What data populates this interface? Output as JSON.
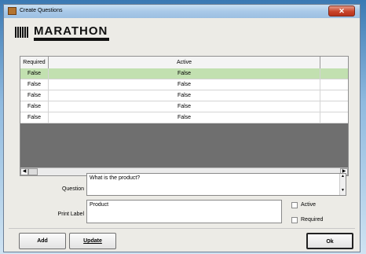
{
  "window": {
    "title": "Create Questions"
  },
  "logo": {
    "text": "MARATHON"
  },
  "grid": {
    "columns": {
      "required": "Required",
      "active": "Active"
    },
    "rows": [
      {
        "required": "False",
        "active": "False",
        "selected": true
      },
      {
        "required": "False",
        "active": "False",
        "selected": false
      },
      {
        "required": "False",
        "active": "False",
        "selected": false
      },
      {
        "required": "False",
        "active": "False",
        "selected": false
      },
      {
        "required": "False",
        "active": "False",
        "selected": false
      }
    ]
  },
  "form": {
    "question_label": "Question",
    "question_value": "What is the product?",
    "print_label_label": "Print Label",
    "print_label_value": "Product",
    "active_label": "Active",
    "required_label": "Required"
  },
  "buttons": {
    "add": "Add",
    "update": "Update",
    "ok": "Ok"
  },
  "icons": {
    "close": "close-icon",
    "app": "app-icon"
  }
}
